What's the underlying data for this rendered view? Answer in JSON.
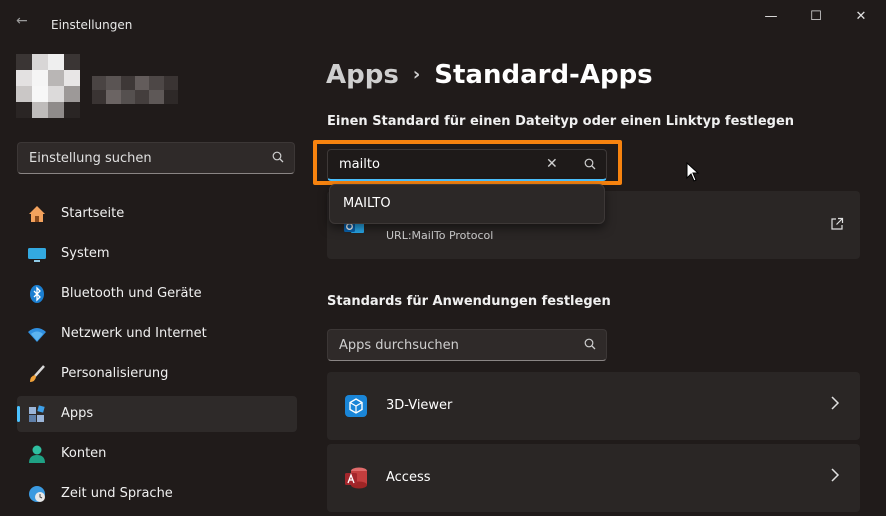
{
  "window": {
    "title": "Einstellungen",
    "controls": {
      "minimize": "—",
      "maximize": "☐",
      "close": "✕"
    }
  },
  "sidebar": {
    "search_placeholder": "Einstellung suchen",
    "items": [
      {
        "label": "Startseite",
        "icon": "home-icon"
      },
      {
        "label": "System",
        "icon": "system-icon"
      },
      {
        "label": "Bluetooth und Geräte",
        "icon": "bluetooth-icon"
      },
      {
        "label": "Netzwerk und Internet",
        "icon": "wifi-icon"
      },
      {
        "label": "Personalisierung",
        "icon": "brush-icon"
      },
      {
        "label": "Apps",
        "icon": "apps-icon",
        "active": true
      },
      {
        "label": "Konten",
        "icon": "account-icon"
      },
      {
        "label": "Zeit und Sprache",
        "icon": "clock-globe-icon"
      }
    ]
  },
  "header": {
    "breadcrumb_parent": "Apps",
    "breadcrumb_separator": "›",
    "breadcrumb_current": "Standard-Apps"
  },
  "filetype_section": {
    "heading": "Einen Standard für einen Dateityp oder einen Linktyp festlegen",
    "input_value": "mailto",
    "suggestion": "MAILTO",
    "result_subtitle": "URL:MailTo Protocol"
  },
  "apps_section": {
    "heading": "Standards für Anwendungen festlegen",
    "search_placeholder": "Apps durchsuchen",
    "apps": [
      {
        "name": "3D-Viewer",
        "icon": "cube-icon"
      },
      {
        "name": "Access",
        "icon": "access-icon"
      }
    ]
  },
  "colors": {
    "accent": "#4cc2ff",
    "highlight": "#f7830f",
    "background": "#201b1a",
    "card": "#2a2625"
  }
}
